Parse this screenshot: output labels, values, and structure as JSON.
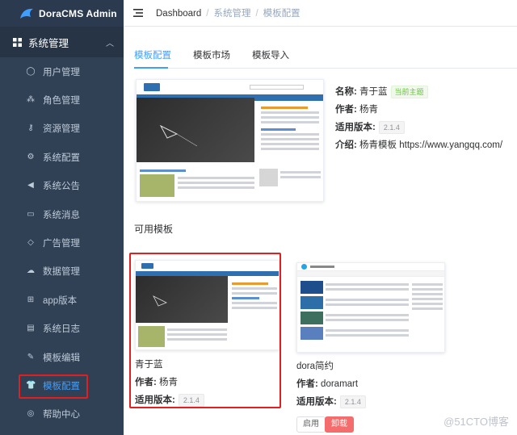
{
  "app": {
    "title": "DoraCMS Admin"
  },
  "sidebar": {
    "group_label": "系统管理",
    "items": [
      {
        "label": "用户管理",
        "icon": "user-icon"
      },
      {
        "label": "角色管理",
        "icon": "role-icon"
      },
      {
        "label": "资源管理",
        "icon": "key-icon"
      },
      {
        "label": "系统配置",
        "icon": "gear-icon"
      },
      {
        "label": "系统公告",
        "icon": "megaphone-icon"
      },
      {
        "label": "系统消息",
        "icon": "message-icon"
      },
      {
        "label": "广告管理",
        "icon": "tag-icon"
      },
      {
        "label": "数据管理",
        "icon": "database-icon"
      },
      {
        "label": "app版本",
        "icon": "app-icon"
      },
      {
        "label": "系统日志",
        "icon": "log-icon"
      },
      {
        "label": "模板编辑",
        "icon": "edit-icon"
      },
      {
        "label": "模板配置",
        "icon": "shirt-icon"
      },
      {
        "label": "帮助中心",
        "icon": "help-icon"
      }
    ],
    "active_index": 11
  },
  "breadcrumb": {
    "home": "Dashboard",
    "level1": "系统管理",
    "level2": "模板配置",
    "separator": "/"
  },
  "tabs": [
    {
      "label": "模板配置"
    },
    {
      "label": "模板市场"
    },
    {
      "label": "模板导入"
    }
  ],
  "current_theme": {
    "name_label": "名称:",
    "name": "青于蓝",
    "badge": "当前主题",
    "author_label": "作者:",
    "author": "杨青",
    "version_label": "适用版本:",
    "version": "2.1.4",
    "intro_label": "介绍:",
    "intro": "杨青模板 https://www.yangqq.com/"
  },
  "available": {
    "title": "可用模板",
    "cards": [
      {
        "name": "青于蓝",
        "author_label": "作者:",
        "author": "杨青",
        "version_label": "适用版本:",
        "version": "2.1.4"
      },
      {
        "name": "dora简约",
        "author_label": "作者:",
        "author": "doramart",
        "version_label": "适用版本:",
        "version": "2.1.4",
        "enable_label": "启用",
        "uninstall_label": "卸载"
      }
    ]
  },
  "watermark": "@51CTO博客",
  "colors": {
    "sidebar_bg": "#304156",
    "accent": "#409eff",
    "success": "#67c23a",
    "danger": "#f56c6c",
    "highlight_box": "#e02020"
  }
}
